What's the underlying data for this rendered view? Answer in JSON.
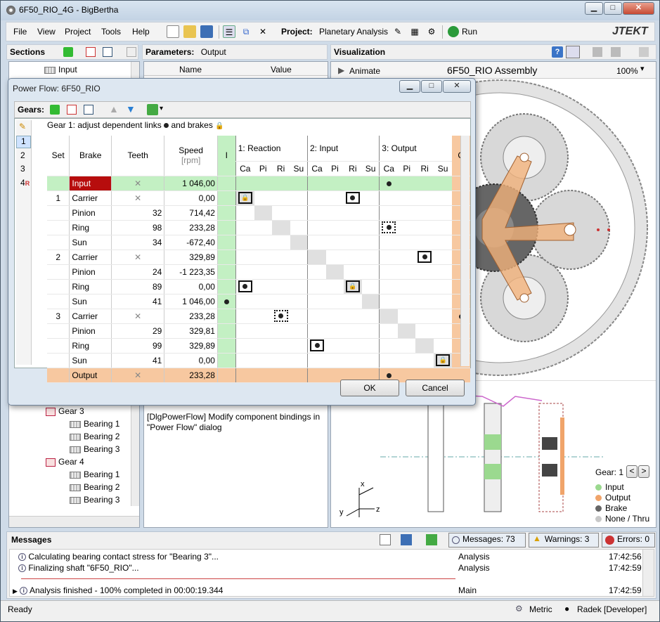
{
  "window": {
    "title": "6F50_RIO_4G - BigBertha",
    "min": "▁",
    "max": "□",
    "close": "✕"
  },
  "menu": {
    "items": [
      "File",
      "View",
      "Project",
      "Tools",
      "Help"
    ],
    "project_label": "Project:",
    "project_name": "Planetary Analysis",
    "run": "Run",
    "logo": "JTEKT"
  },
  "sections": {
    "title": "Sections",
    "top_item": "Input",
    "tree": [
      {
        "label": "Gear 3",
        "type": "gear"
      },
      {
        "label": "Bearing 1",
        "type": "bearing"
      },
      {
        "label": "Bearing 2",
        "type": "bearing"
      },
      {
        "label": "Bearing 3",
        "type": "bearing"
      },
      {
        "label": "Gear 4",
        "type": "gear"
      },
      {
        "label": "Bearing 1",
        "type": "bearing"
      },
      {
        "label": "Bearing 2",
        "type": "bearing"
      },
      {
        "label": "Bearing 3",
        "type": "bearing"
      }
    ]
  },
  "parameters": {
    "title": "Parameters:",
    "target": "Output",
    "col_name": "Name",
    "col_value": "Value",
    "description": "[DlgPowerFlow] Modify component bindings in \"Power Flow\" dialog"
  },
  "visualization": {
    "title": "Visualization",
    "animate": "Animate",
    "assembly": "6F50_RIO Assembly",
    "zoom": "100%",
    "gear_label": "Gear: 1",
    "legend": [
      {
        "label": "Input",
        "color": "#9bd98f"
      },
      {
        "label": "Output",
        "color": "#f0a46a"
      },
      {
        "label": "Brake",
        "color": "#666666"
      },
      {
        "label": "None / Thru",
        "color": "#c8c8c8"
      }
    ],
    "axes": {
      "x": "x",
      "y": "y",
      "z": "z"
    }
  },
  "dialog": {
    "title": "Power Flow: 6F50_RIO",
    "gears_label": "Gears:",
    "hint_prefix": "Gear 1: adjust dependent links",
    "hint_mid": "and brakes",
    "gear_list": [
      "1",
      "2",
      "3",
      "4"
    ],
    "gear4_flag": "R",
    "headers": {
      "set": "Set",
      "brake": "Brake",
      "teeth": "Teeth",
      "speed": "Speed",
      "speed_unit": "[rpm]",
      "i": "I",
      "o": "O",
      "groups": [
        "1: Reaction",
        "2: Input",
        "3: Output"
      ],
      "sub": [
        "Ca",
        "Pi",
        "Ri",
        "Su"
      ]
    },
    "rows": [
      {
        "set": "",
        "brake": "Input",
        "teeth": "",
        "speed": "1 046,00",
        "kind": "input",
        "x": true
      },
      {
        "set": "1",
        "brake": "Carrier",
        "teeth": "",
        "speed": "0,00",
        "x": true
      },
      {
        "set": "",
        "brake": "Pinion",
        "teeth": "32",
        "speed": "714,42"
      },
      {
        "set": "",
        "brake": "Ring",
        "teeth": "98",
        "speed": "233,28"
      },
      {
        "set": "",
        "brake": "Sun",
        "teeth": "34",
        "speed": "-672,40"
      },
      {
        "set": "2",
        "brake": "Carrier",
        "teeth": "",
        "speed": "329,89",
        "x": true
      },
      {
        "set": "",
        "brake": "Pinion",
        "teeth": "24",
        "speed": "-1 223,35"
      },
      {
        "set": "",
        "brake": "Ring",
        "teeth": "89",
        "speed": "0,00"
      },
      {
        "set": "",
        "brake": "Sun",
        "teeth": "41",
        "speed": "1 046,00"
      },
      {
        "set": "3",
        "brake": "Carrier",
        "teeth": "",
        "speed": "233,28",
        "x": true
      },
      {
        "set": "",
        "brake": "Pinion",
        "teeth": "29",
        "speed": "329,81"
      },
      {
        "set": "",
        "brake": "Ring",
        "teeth": "99",
        "speed": "329,89"
      },
      {
        "set": "",
        "brake": "Sun",
        "teeth": "41",
        "speed": "0,00"
      },
      {
        "set": "",
        "brake": "Output",
        "teeth": "",
        "speed": "233,28",
        "kind": "output",
        "x": true
      }
    ],
    "ok": "OK",
    "cancel": "Cancel"
  },
  "messages": {
    "title": "Messages",
    "count": "Messages: 73",
    "warnings": "Warnings: 3",
    "errors": "Errors: 0",
    "rows": [
      {
        "text": "Calculating bearing contact stress for \"Bearing 3\"...",
        "cat": "Analysis",
        "time": "17:42:56"
      },
      {
        "text": "Finalizing shaft \"6F50_RIO\"...",
        "cat": "Analysis",
        "time": "17:42:59"
      },
      {
        "text": "Analysis finished - 100% completed in 00:00:19.344",
        "cat": "Main",
        "time": "17:42:59"
      }
    ]
  },
  "status": {
    "ready": "Ready",
    "units": "Metric",
    "user": "Radek [Developer]"
  }
}
